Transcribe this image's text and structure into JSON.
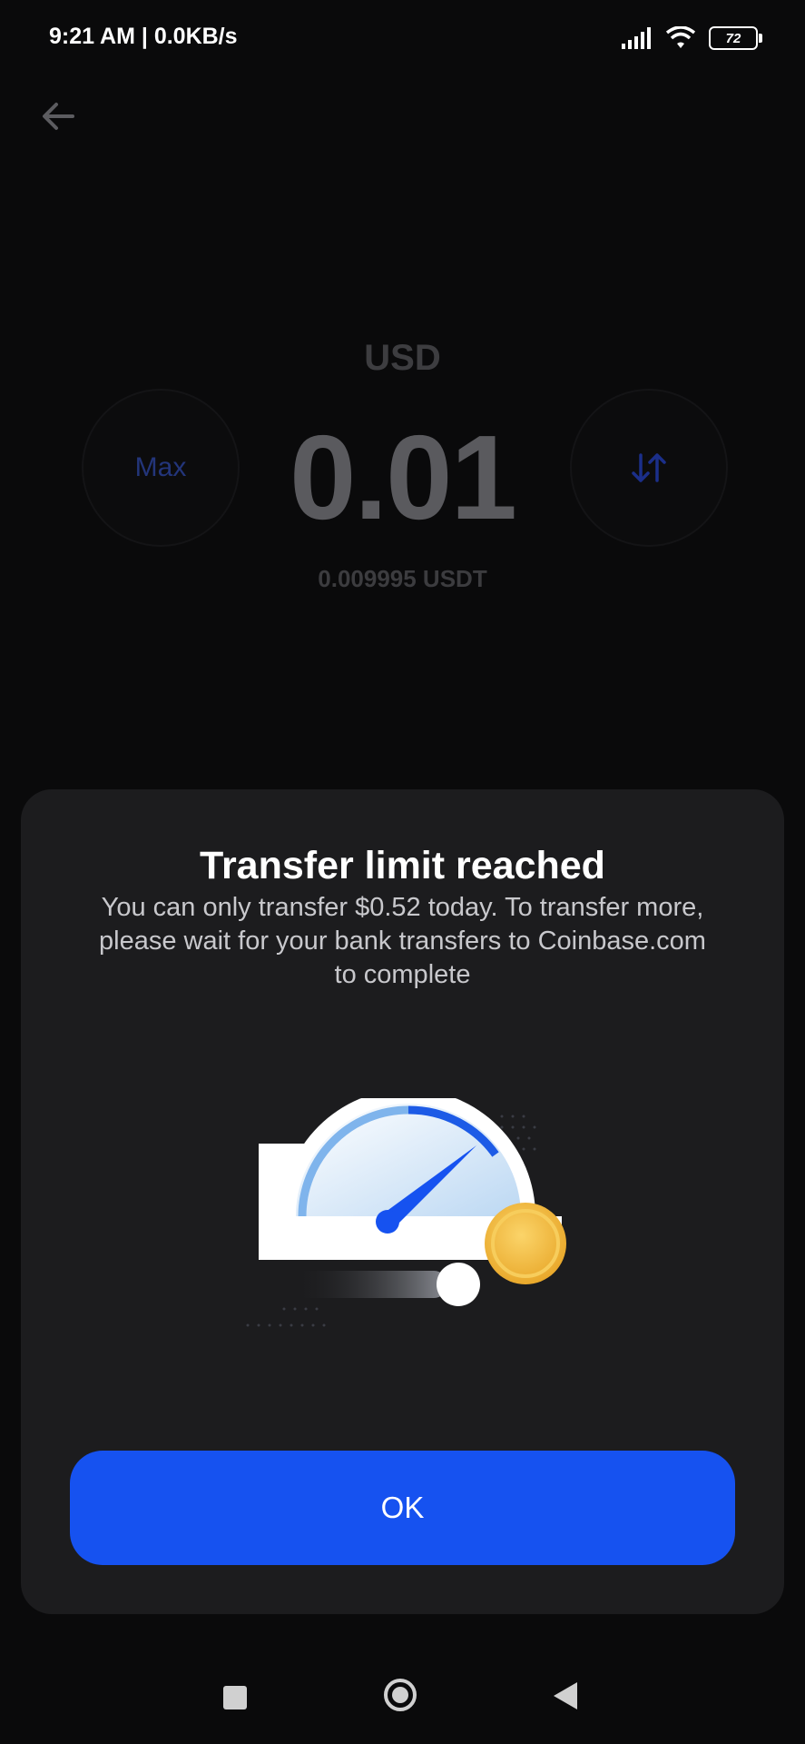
{
  "status_bar": {
    "time": "9:21 AM | 0.0KB/s",
    "battery": "72",
    "icons": [
      "signal-icon",
      "wifi-icon",
      "battery-icon"
    ]
  },
  "header": {
    "back_icon": "arrow-left-icon"
  },
  "amount_screen": {
    "currency": "USD",
    "amount": "0.01",
    "converted": "0.009995 USDT",
    "max_label": "Max",
    "swap_icon": "swap-vertical-icon"
  },
  "modal": {
    "title": "Transfer limit reached",
    "body": "You can only transfer $0.52 today. To transfer more, please wait for your bank transfers to Coinbase.com to complete",
    "illustration": "speedometer-coin-illustration",
    "ok_label": "OK"
  },
  "nav_bar": {
    "icons": [
      "recents-icon",
      "home-icon",
      "back-icon"
    ]
  },
  "colors": {
    "accent": "#1652f0",
    "modal_bg": "#1c1c1e",
    "screen_bg": "#0a0a0b",
    "coin": "#f5c24b"
  }
}
